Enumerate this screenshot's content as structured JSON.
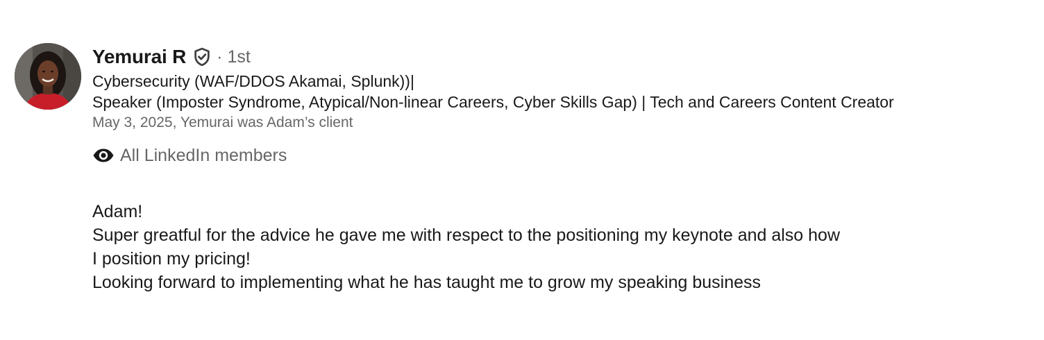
{
  "recommendation": {
    "author": {
      "name": "Yemurai R",
      "verified_icon": "shield-check-icon",
      "separator": "·",
      "degree": "1st",
      "headline_line1": "Cybersecurity (WAF/DDOS Akamai, Splunk))|",
      "headline_line2": "Speaker (Imposter Syndrome, Atypical/Non-linear Careers, Cyber Skills Gap) | Tech and Careers Content Creator",
      "meta": "May 3, 2025, Yemurai was Adam’s client"
    },
    "visibility": {
      "icon": "eye-icon",
      "label": "All LinkedIn members"
    },
    "body": {
      "line1": "Adam!",
      "line2": "Super greatful for the advice he gave me with respect to the positioning my keynote and also how",
      "line3": "I position my pricing!",
      "line4": "Looking forward to implementing what he has taught me to grow my speaking business"
    }
  },
  "colors": {
    "primary_text": "#191919",
    "secondary_text": "#666666",
    "background": "#ffffff"
  }
}
